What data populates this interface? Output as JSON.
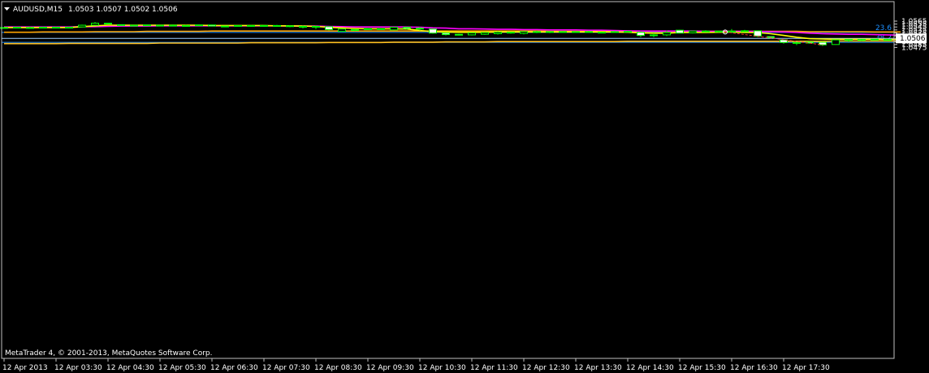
{
  "header": {
    "menu_icon": "triangle-down-icon",
    "symbol": "AUDUSD,M15",
    "ohlc": "1.0503 1.0507 1.0502 1.0506"
  },
  "footer": {
    "copyright": "MetaTrader 4, © 2001-2013, MetaQuotes Software Corp."
  },
  "colors": {
    "background": "#000000",
    "grid_frame": "#c0c0c0",
    "candle_up_body": "#000000",
    "candle_down_body": "#ffffff",
    "candle_outline": "#00ff00",
    "ma_fast": "#ffff00",
    "ma_mid": "#ff00ff",
    "ma_slow": "#ffa500",
    "ma_long": "#ffc020",
    "fib_line": "#1e90ff",
    "price_line": "#a0d0ff",
    "trade_line": "#ff3030"
  },
  "chart_data": {
    "type": "candlestick",
    "ylim": [
      1.047,
      1.0563
    ],
    "y_ticks": [
      "1.0565",
      "1.0555",
      "1.0545",
      "1.0535",
      "1.0525",
      "1.0515",
      "1.0505",
      "1.0495",
      "1.0485",
      "1.0475"
    ],
    "y_tick_values": [
      1.0565,
      1.0555,
      1.0545,
      1.0535,
      1.0525,
      1.0515,
      1.0505,
      1.0495,
      1.0485,
      1.0475
    ],
    "x_ticks": [
      "12 Apr 2013",
      "12 Apr 03:30",
      "12 Apr 04:30",
      "12 Apr 05:30",
      "12 Apr 06:30",
      "12 Apr 07:30",
      "12 Apr 08:30",
      "12 Apr 09:30",
      "12 Apr 10:30",
      "12 Apr 11:30",
      "12 Apr 12:30",
      "12 Apr 13:30",
      "12 Apr 14:30",
      "12 Apr 15:30",
      "12 Apr 16:30",
      "12 Apr 17:30"
    ],
    "x_tick_bar_index": [
      0,
      4,
      8,
      12,
      16,
      20,
      24,
      28,
      32,
      36,
      40,
      44,
      48,
      52,
      56,
      60
    ],
    "current_price": 1.0506,
    "current_price_label": "1.0506",
    "fib_levels": [
      {
        "label": "23.6",
        "value": 1.05265
      },
      {
        "label": "38.2",
        "value": 1.04925
      }
    ],
    "candles": [
      [
        1.0543,
        1.0545,
        1.054,
        1.0542
      ],
      [
        1.0542,
        1.0545,
        1.0541,
        1.0544
      ],
      [
        1.0543,
        1.0546,
        1.0541,
        1.0542
      ],
      [
        1.0542,
        1.0546,
        1.054,
        1.0544
      ],
      [
        1.0544,
        1.0546,
        1.0541,
        1.0542
      ],
      [
        1.0542,
        1.0546,
        1.054,
        1.0544
      ],
      [
        1.0545,
        1.0553,
        1.0544,
        1.0551
      ],
      [
        1.0551,
        1.0562,
        1.055,
        1.0558
      ],
      [
        1.0558,
        1.0559,
        1.0555,
        1.0556
      ],
      [
        1.0553,
        1.0554,
        1.0549,
        1.055
      ],
      [
        1.0551,
        1.0553,
        1.0549,
        1.0551
      ],
      [
        1.0552,
        1.0553,
        1.0549,
        1.055
      ],
      [
        1.055,
        1.0553,
        1.0549,
        1.0551
      ],
      [
        1.0551,
        1.0554,
        1.0548,
        1.0549
      ],
      [
        1.0549,
        1.0552,
        1.0547,
        1.055
      ],
      [
        1.055,
        1.0554,
        1.0549,
        1.0552
      ],
      [
        1.0552,
        1.0553,
        1.0547,
        1.0548
      ],
      [
        1.0548,
        1.0549,
        1.0545,
        1.0548
      ],
      [
        1.0549,
        1.0551,
        1.0547,
        1.055
      ],
      [
        1.055,
        1.0552,
        1.0546,
        1.0548
      ],
      [
        1.0548,
        1.0552,
        1.0546,
        1.055
      ],
      [
        1.055,
        1.0552,
        1.0547,
        1.0549
      ],
      [
        1.0549,
        1.0551,
        1.0544,
        1.0547
      ],
      [
        1.0547,
        1.055,
        1.054,
        1.0547
      ],
      [
        1.0547,
        1.055,
        1.0538,
        1.0546
      ],
      [
        1.0546,
        1.0548,
        1.0533,
        1.0536
      ],
      [
        1.053,
        1.0538,
        1.0529,
        1.0538
      ],
      [
        1.0534,
        1.0537,
        1.0531,
        1.0536
      ],
      [
        1.0537,
        1.0541,
        1.0535,
        1.0539
      ],
      [
        1.0539,
        1.0541,
        1.0536,
        1.0538
      ],
      [
        1.0535,
        1.0545,
        1.0534,
        1.0544
      ],
      [
        1.0544,
        1.0546,
        1.0535,
        1.054
      ],
      [
        1.0541,
        1.0545,
        1.0533,
        1.0538
      ],
      [
        1.0538,
        1.0539,
        1.0522,
        1.0524
      ],
      [
        1.0524,
        1.0525,
        1.0516,
        1.0519
      ],
      [
        1.052,
        1.0522,
        1.0516,
        1.0517
      ],
      [
        1.0518,
        1.0526,
        1.0516,
        1.0525
      ],
      [
        1.052,
        1.0527,
        1.0518,
        1.0526
      ],
      [
        1.0522,
        1.053,
        1.0519,
        1.0527
      ],
      [
        1.0527,
        1.0528,
        1.0522,
        1.0525
      ],
      [
        1.0523,
        1.0531,
        1.052,
        1.0529
      ],
      [
        1.0529,
        1.0532,
        1.0524,
        1.0527
      ],
      [
        1.0528,
        1.053,
        1.0524,
        1.0529
      ],
      [
        1.0529,
        1.0531,
        1.0525,
        1.0528
      ],
      [
        1.0528,
        1.053,
        1.0526,
        1.0529
      ],
      [
        1.0529,
        1.0532,
        1.0525,
        1.0527
      ],
      [
        1.0527,
        1.0529,
        1.0524,
        1.0526
      ],
      [
        1.0527,
        1.0531,
        1.0525,
        1.0529
      ],
      [
        1.053,
        1.0532,
        1.0526,
        1.0529
      ],
      [
        1.0527,
        1.053,
        1.051,
        1.0516
      ],
      [
        1.0517,
        1.0524,
        1.051,
        1.0518
      ],
      [
        1.0518,
        1.0533,
        1.0514,
        1.0526
      ],
      [
        1.0534,
        1.0535,
        1.0524,
        1.0524
      ],
      [
        1.0525,
        1.0532,
        1.0523,
        1.0531
      ],
      [
        1.0529,
        1.0534,
        1.0527,
        1.0531
      ],
      [
        1.053,
        1.0532,
        1.0526,
        1.0531
      ],
      [
        1.0528,
        1.0538,
        1.0526,
        1.0531
      ],
      [
        1.053,
        1.0535,
        1.0527,
        1.0532
      ],
      [
        1.0532,
        1.0533,
        1.051,
        1.0514
      ],
      [
        1.0512,
        1.0513,
        1.0507,
        1.0508
      ],
      [
        1.0501,
        1.0502,
        1.0488,
        1.0492
      ],
      [
        1.0492,
        1.0494,
        1.0483,
        1.0489
      ],
      [
        1.0494,
        1.0496,
        1.0488,
        1.049
      ],
      [
        1.0493,
        1.0495,
        1.048,
        1.0484
      ],
      [
        1.0485,
        1.0501,
        1.0484,
        1.0501
      ],
      [
        1.0499,
        1.0503,
        1.0494,
        1.0502
      ],
      [
        1.0501,
        1.0504,
        1.0497,
        1.0502
      ],
      [
        1.0503,
        1.0504,
        1.05,
        1.0501
      ],
      [
        1.0502,
        1.0504,
        1.05,
        1.0501
      ],
      [
        1.0503,
        1.0507,
        1.0502,
        1.0506
      ]
    ],
    "ma_fast": [
      1.0543,
      1.0543,
      1.0543,
      1.0543,
      1.0543,
      1.0543,
      1.0546,
      1.0549,
      1.0551,
      1.0551,
      1.0551,
      1.0551,
      1.0551,
      1.0551,
      1.0551,
      1.0551,
      1.055,
      1.055,
      1.055,
      1.055,
      1.055,
      1.0549,
      1.0549,
      1.0548,
      1.0547,
      1.0544,
      1.0542,
      1.054,
      1.0539,
      1.0539,
      1.0539,
      1.0538,
      1.0533,
      1.0529,
      1.0528,
      1.0527,
      1.0527,
      1.0527,
      1.0528,
      1.0528,
      1.0528,
      1.0528,
      1.0528,
      1.0528,
      1.0528,
      1.0528,
      1.0528,
      1.0528,
      1.0527,
      1.0525,
      1.0524,
      1.0524,
      1.0526,
      1.0526,
      1.0526,
      1.0527,
      1.0528,
      1.0526,
      1.0526,
      1.0522,
      1.0516,
      1.051,
      1.0505,
      1.0504,
      1.0503,
      1.0503,
      1.0503,
      1.0503,
      1.0502,
      1.0503
    ],
    "ma_mid": [
      1.0545,
      1.0545,
      1.0545,
      1.0545,
      1.0545,
      1.0545,
      1.0546,
      1.0546,
      1.0547,
      1.0548,
      1.0548,
      1.0548,
      1.0549,
      1.0549,
      1.0549,
      1.0549,
      1.0549,
      1.0549,
      1.0549,
      1.0549,
      1.0549,
      1.0549,
      1.0548,
      1.0548,
      1.0548,
      1.0547,
      1.0546,
      1.0545,
      1.0545,
      1.0545,
      1.0545,
      1.0545,
      1.0544,
      1.0542,
      1.0541,
      1.0539,
      1.0539,
      1.0538,
      1.0537,
      1.0537,
      1.0536,
      1.0536,
      1.0535,
      1.0535,
      1.0535,
      1.0534,
      1.0534,
      1.0533,
      1.0532,
      1.0531,
      1.0531,
      1.0531,
      1.0531,
      1.0531,
      1.053,
      1.053,
      1.053,
      1.053,
      1.053,
      1.0529,
      1.0528,
      1.0526,
      1.0524,
      1.0522,
      1.0521,
      1.052,
      1.052,
      1.0519,
      1.0518,
      1.0517
    ],
    "ma_slow": [
      1.0527,
      1.0527,
      1.0527,
      1.0528,
      1.0528,
      1.0528,
      1.0528,
      1.0529,
      1.0529,
      1.0529,
      1.0529,
      1.053,
      1.053,
      1.053,
      1.053,
      1.053,
      1.0531,
      1.0531,
      1.0531,
      1.0531,
      1.0531,
      1.0531,
      1.0531,
      1.0531,
      1.0531,
      1.0531,
      1.0531,
      1.0531,
      1.0531,
      1.0531,
      1.0531,
      1.0531,
      1.0531,
      1.0531,
      1.0531,
      1.0531,
      1.0531,
      1.0531,
      1.0531,
      1.0531,
      1.0531,
      1.0531,
      1.053,
      1.053,
      1.053,
      1.053,
      1.053,
      1.053,
      1.053,
      1.053,
      1.053,
      1.053,
      1.053,
      1.053,
      1.053,
      1.053,
      1.053,
      1.053,
      1.053,
      1.053,
      1.053,
      1.053,
      1.0529,
      1.0529,
      1.0529,
      1.0529,
      1.0529,
      1.0528,
      1.0528,
      1.0528
    ],
    "ma_long": [
      1.0488,
      1.0488,
      1.0488,
      1.0488,
      1.0488,
      1.0489,
      1.0489,
      1.0489,
      1.0489,
      1.0489,
      1.0489,
      1.0489,
      1.049,
      1.049,
      1.049,
      1.049,
      1.049,
      1.049,
      1.049,
      1.0491,
      1.0491,
      1.0491,
      1.0491,
      1.0491,
      1.0491,
      1.0492,
      1.0492,
      1.0492,
      1.0492,
      1.0492,
      1.0493,
      1.0493,
      1.0493,
      1.0493,
      1.0494,
      1.0494,
      1.0494,
      1.0494,
      1.0495,
      1.0495,
      1.0495,
      1.0495,
      1.0495,
      1.0495,
      1.0495,
      1.0495,
      1.0495,
      1.0495,
      1.0496,
      1.0496,
      1.0496,
      1.0496,
      1.0496,
      1.0496,
      1.0496,
      1.0496,
      1.0496,
      1.0496,
      1.0496,
      1.0496,
      1.0496,
      1.0496,
      1.0496,
      1.0496,
      1.0497,
      1.0497,
      1.0497,
      1.0497,
      1.0497,
      1.0497
    ],
    "trade_marker": {
      "from_bar": 55.5,
      "from_price": 1.0528,
      "to_bar": 63,
      "to_price": 1.0484
    }
  }
}
